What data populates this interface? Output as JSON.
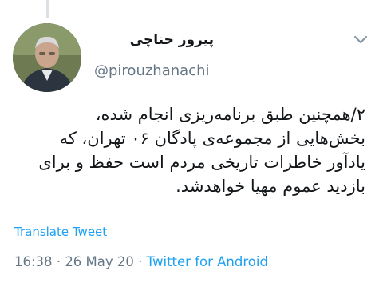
{
  "tweet": {
    "display_name": "پیروز حناچی",
    "handle": "@pirouzhanachi",
    "text_lines": [
      "۲/همچنین طبق برنامه‌ریزی انجام شده،",
      "بخش‌هایی از مجموعه‌ی پادگان ۰۶ تهران، که",
      "یادآور خاطرات تاریخی مردم است حفظ و برای",
      "بازدید عموم مهیا خواهدشد."
    ],
    "translate_label": "Translate Tweet",
    "time": "16:38",
    "date": "26 May 20",
    "source": "Twitter for Android",
    "separator": "·"
  },
  "icons": {
    "menu": "chevron-down-icon",
    "avatar": "avatar"
  },
  "colors": {
    "link": "#1da1f2",
    "muted": "#657786",
    "text": "#14171a",
    "thread": "#dbe0e4"
  }
}
